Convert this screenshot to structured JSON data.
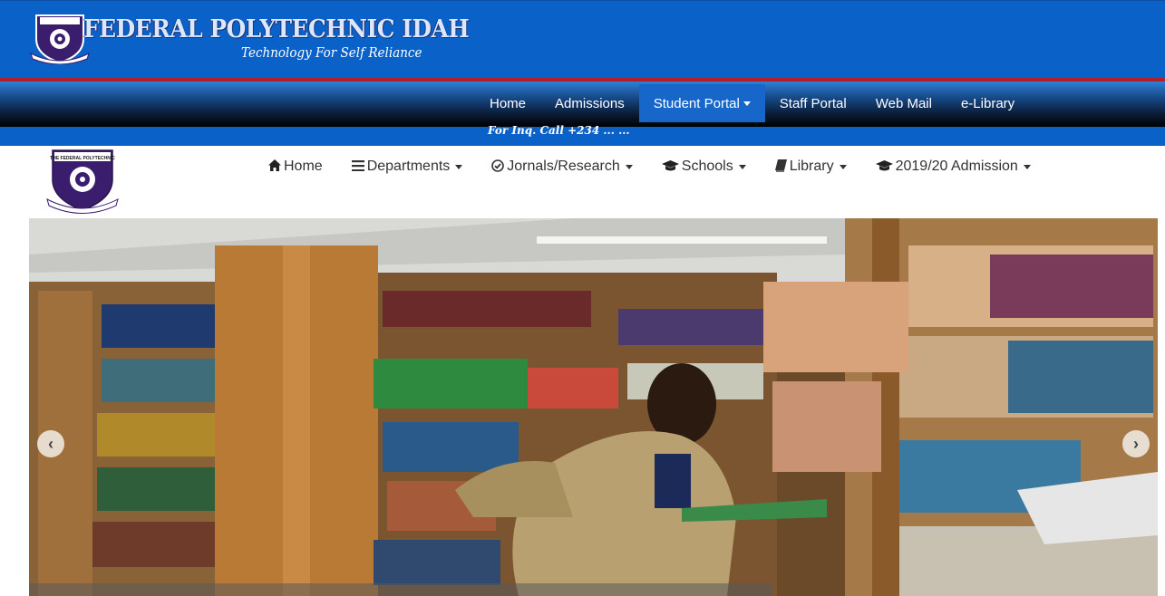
{
  "header": {
    "title": "FEDERAL POLYTECHNIC IDAH",
    "motto": "Technology For Self Reliance",
    "crest_text": "THE FEDERAL POLYTECHNIC"
  },
  "top_nav": {
    "items": [
      {
        "label": "Home",
        "active": false,
        "dropdown": false
      },
      {
        "label": "Admissions",
        "active": false,
        "dropdown": false
      },
      {
        "label": "Student Portal",
        "active": true,
        "dropdown": true
      },
      {
        "label": "Staff Portal",
        "active": false,
        "dropdown": false
      },
      {
        "label": "Web Mail",
        "active": false,
        "dropdown": false
      },
      {
        "label": "e-Library",
        "active": false,
        "dropdown": false
      }
    ]
  },
  "inquiry": "For Inq. Call +234 ... ...",
  "secondary_nav": {
    "items": [
      {
        "label": "Home",
        "icon": "home-icon",
        "dropdown": false
      },
      {
        "label": "Departments",
        "icon": "list-icon",
        "dropdown": true
      },
      {
        "label": "Jornals/Research",
        "icon": "check-circle-icon",
        "dropdown": true
      },
      {
        "label": "Schools",
        "icon": "graduation-cap-icon",
        "dropdown": true
      },
      {
        "label": "Library",
        "icon": "book-icon",
        "dropdown": true
      },
      {
        "label": "2019/20 Admission",
        "icon": "graduation-cap-icon",
        "dropdown": true
      }
    ]
  },
  "carousel": {
    "prev_icon": "chevron-left-icon",
    "next_icon": "chevron-right-icon"
  },
  "colors": {
    "banner": "#0a62c8",
    "active_nav": "#1667c9",
    "red_rule": "#b0202a"
  }
}
